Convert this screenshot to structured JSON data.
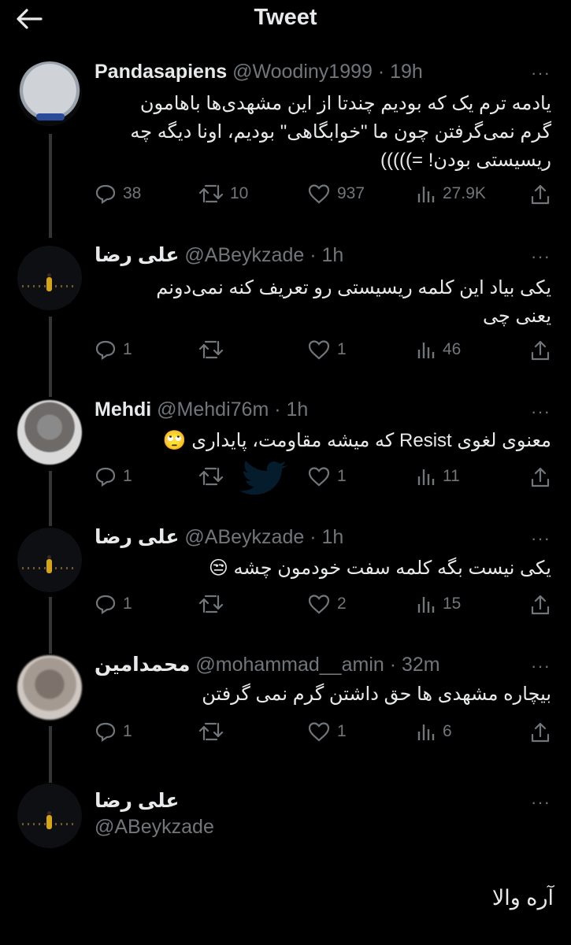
{
  "header": {
    "title": "Tweet",
    "back_icon": "arrow-left-icon"
  },
  "tweets": [
    {
      "name": "Pandasapiens",
      "meta": "@Woodiny1999 · 19h",
      "text": "یادمه ترم یک که بودیم چندتا از این مشهدی‌ها باهامون\nگرم نمی‌گرفتن چون ما \"خوابگاهی\" بودیم، اونا دیگه چه\nریسیستی بودن! =)))))",
      "replies": "38",
      "retweets": "10",
      "likes": "937",
      "views": "27.9K"
    },
    {
      "name": "علی رضا",
      "meta": "@ABeykzade · 1h",
      "text": "یکی بیاد این کلمه ریسیستی رو تعریف کنه نمی‌دونم\nیعنی چی",
      "replies": "1",
      "retweets": "",
      "likes": "1",
      "views": "46"
    },
    {
      "name": "Mehdi",
      "meta": "@Mehdi76m · 1h",
      "text": "معنوی لغوی Resist که میشه مقاومت، پایداری 🙄",
      "replies": "1",
      "retweets": "",
      "likes": "1",
      "views": "11"
    },
    {
      "name": "علی رضا",
      "meta": "@ABeykzade · 1h",
      "text": "یکی نیست بگه کلمه سفت خودمون چشه 😒",
      "replies": "1",
      "retweets": "",
      "likes": "2",
      "views": "15"
    },
    {
      "name": "محمدامین",
      "meta": "@mohammad__amin · 32m",
      "text": "بیچاره مشهدی ها حق داشتن گرم نمی گرفتن",
      "replies": "1",
      "retweets": "",
      "likes": "1",
      "views": "6"
    }
  ],
  "main_tweet": {
    "name": "علی رضا",
    "handle": "@ABeykzade",
    "text": "آره والا"
  },
  "more_label": "···",
  "colors": {
    "background": "#000000",
    "text": "#e7e9ea",
    "muted": "#71767b",
    "thread": "#333639"
  }
}
